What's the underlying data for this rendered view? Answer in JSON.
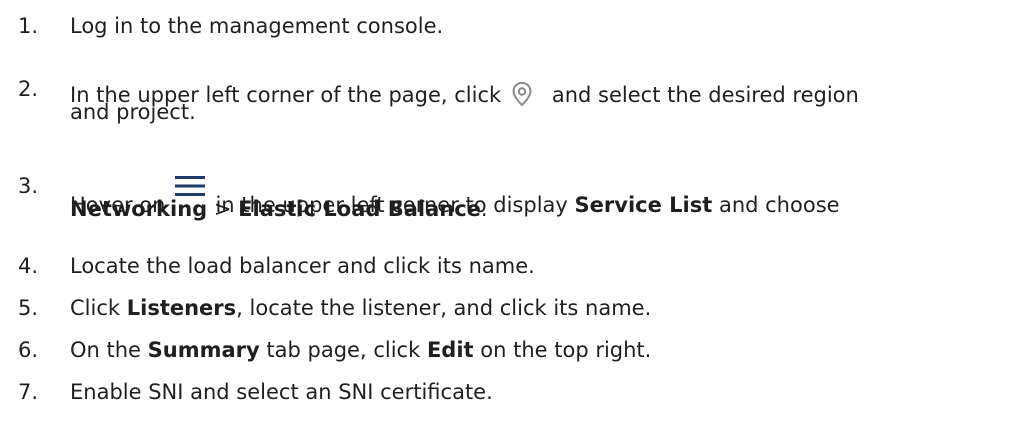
{
  "steps": [
    {
      "num": "1.",
      "text": "Log in to the management console."
    },
    {
      "num": "2.",
      "pre": "In the upper left corner of the page, click",
      "icon": "location-pin-icon",
      "post": "and select the desired region",
      "line2": "and project."
    },
    {
      "num": "3.",
      "pre": "Hover on",
      "icon": "menu-icon",
      "post_a": "in the upper left corner to display",
      "bold_a": "Service List",
      "post_b": "and choose",
      "l2_bold_a": "Networking",
      "l2_sep": ">",
      "l2_bold_b": "Elastic Load Balance",
      "l2_end": "."
    },
    {
      "num": "4.",
      "text": "Locate the load balancer and click its name."
    },
    {
      "num": "5.",
      "pre": "Click",
      "bold": "Listeners",
      "post": ", locate the listener, and click its name."
    },
    {
      "num": "6.",
      "pre": "On the",
      "bold_a": "Summary",
      "mid": "tab page, click",
      "bold_b": "Edit",
      "post": "on the top right."
    },
    {
      "num": "7.",
      "text": "Enable SNI and select an SNI certificate."
    }
  ],
  "colors": {
    "text": "#1f1f1f",
    "icon": "#8a8a8a",
    "menu": "#1f3a6b"
  }
}
